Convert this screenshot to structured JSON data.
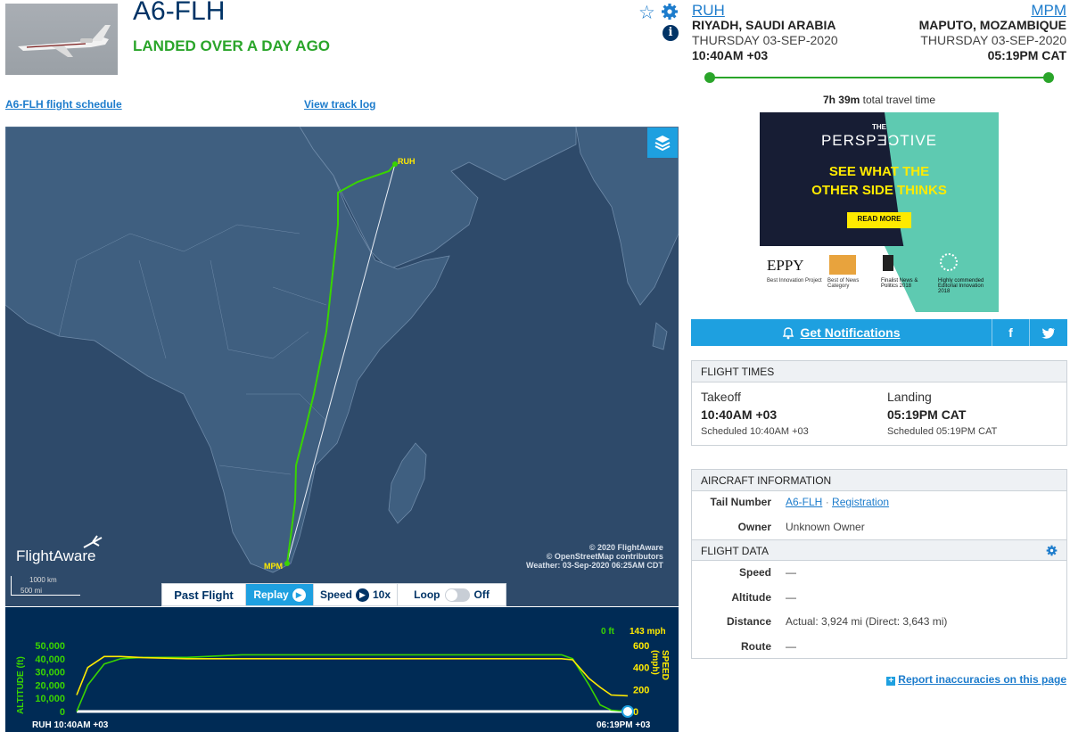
{
  "flight": {
    "tail": "A6-FLH",
    "status": "LANDED OVER A DAY AGO",
    "schedule_link": "A6-FLH flight schedule",
    "tracklog_link": "View track log"
  },
  "origin": {
    "code": "RUH",
    "city": "RIYADH, SAUDI ARABIA",
    "date": "THURSDAY 03-SEP-2020",
    "time": "10:40AM +03"
  },
  "destination": {
    "code": "MPM",
    "city": "MAPUTO, MOZAMBIQUE",
    "date": "THURSDAY 03-SEP-2020",
    "time": "05:19PM CAT"
  },
  "travel": {
    "duration": "7h 39m",
    "suffix": "total travel time"
  },
  "progress_fraction": 1.0,
  "map": {
    "origin_label": "RUH",
    "dest_label": "MPM",
    "logo": "FlightAware",
    "scale_km": "1000 km",
    "scale_mi": "500 mi",
    "attribution": [
      "© 2020 FlightAware",
      "© OpenStreetMap contributors",
      "Weather: 03-Sep-2020 06:25AM CDT"
    ]
  },
  "replay": {
    "past_flight": "Past Flight",
    "replay": "Replay",
    "speed_label": "Speed",
    "speed_value": "10x",
    "loop_label": "Loop",
    "loop_state": "Off"
  },
  "chart": {
    "altitude_axis_title": "ALTITUDE (ft)",
    "speed_axis_title": "SPEED (mph)",
    "altitude_ticks": [
      "50,000",
      "40,000",
      "30,000",
      "20,000",
      "10,000",
      "0"
    ],
    "speed_ticks": [
      "600",
      "400",
      "200",
      "0"
    ],
    "current_altitude": "0 ft",
    "current_speed": "143 mph",
    "start_label": "RUH 10:40AM +03",
    "end_label": "06:19PM +03"
  },
  "chart_data": {
    "type": "line",
    "title": "",
    "xlabel": "",
    "series": [
      {
        "name": "ALTITUDE (ft)",
        "x": [
          0,
          0.02,
          0.05,
          0.08,
          0.12,
          0.2,
          0.3,
          0.55,
          0.75,
          0.88,
          0.9,
          0.93,
          0.95,
          0.97,
          1.0
        ],
        "values": [
          0,
          20000,
          36000,
          40000,
          41000,
          41000,
          43000,
          43000,
          43000,
          43000,
          40000,
          20000,
          5000,
          1000,
          0
        ]
      },
      {
        "name": "SPEED (mph)",
        "x": [
          0,
          0.02,
          0.05,
          0.08,
          0.12,
          0.2,
          0.3,
          0.55,
          0.75,
          0.88,
          0.9,
          0.93,
          0.95,
          0.97,
          1.0
        ],
        "values": [
          150,
          400,
          500,
          500,
          490,
          480,
          480,
          480,
          480,
          480,
          470,
          300,
          220,
          150,
          143
        ]
      }
    ],
    "ylim_altitude": [
      0,
      50000
    ],
    "ylim_speed": [
      0,
      600
    ]
  },
  "notifications": {
    "label": "Get Notifications",
    "facebook": "f",
    "twitter": "t"
  },
  "ad": {
    "brand_prefix": "THE",
    "brand": "PERSPƎƆTIVE",
    "headline1": "SEE WHAT THE",
    "headline2": "OTHER SIDE THINKS",
    "cta": "READ MORE",
    "award1": "EPPY",
    "award1_sub": "Best Innovation Project",
    "award2_sub": "Best of News Category",
    "award3_sub": "Finalist News & Politics 2018",
    "award4_sub": "Highly commended Editorial Innovation 2018"
  },
  "flight_times": {
    "title": "FLIGHT TIMES",
    "takeoff_label": "Takeoff",
    "takeoff_time": "10:40AM +03",
    "takeoff_scheduled": "Scheduled 10:40AM +03",
    "landing_label": "Landing",
    "landing_time": "05:19PM CAT",
    "landing_scheduled": "Scheduled 05:19PM CAT"
  },
  "aircraft": {
    "title": "AIRCRAFT INFORMATION",
    "tail_label": "Tail Number",
    "tail_value": "A6-FLH",
    "separator": "·",
    "registration": "Registration",
    "owner_label": "Owner",
    "owner_value": "Unknown Owner"
  },
  "flight_data": {
    "title": "FLIGHT DATA",
    "speed_label": "Speed",
    "speed_value": "—",
    "altitude_label": "Altitude",
    "altitude_value": "—",
    "distance_label": "Distance",
    "distance_value": "Actual: 3,924 mi (Direct: 3,643 mi)",
    "route_label": "Route",
    "route_value": "—"
  },
  "report_link": "Report inaccuracies on this page",
  "colors": {
    "accent": "#1ea0e0",
    "landed": "#2aa52a",
    "dark_blue": "#003366",
    "track": "#39d400"
  }
}
